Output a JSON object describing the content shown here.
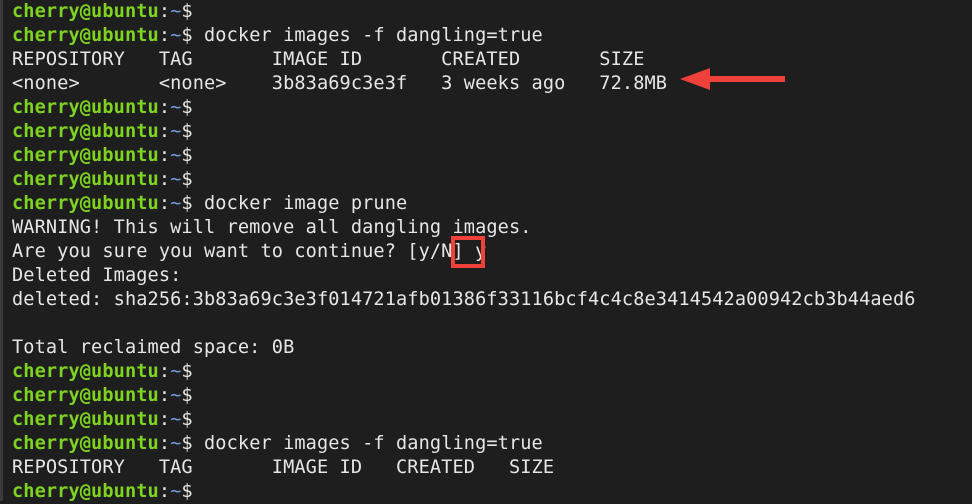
{
  "terminal": {
    "prompt": {
      "user_host": "cherry@ubuntu",
      "colon": ":",
      "path": "~",
      "symbol": "$"
    },
    "lines": [
      {
        "type": "prompt",
        "command": ""
      },
      {
        "type": "prompt",
        "command": " docker images -f dangling=true"
      },
      {
        "type": "output",
        "text": "REPOSITORY   TAG       IMAGE ID       CREATED       SIZE"
      },
      {
        "type": "output",
        "text": "<none>       <none>    3b83a69c3e3f   3 weeks ago   72.8MB"
      },
      {
        "type": "prompt",
        "command": ""
      },
      {
        "type": "prompt",
        "command": ""
      },
      {
        "type": "prompt",
        "command": ""
      },
      {
        "type": "prompt",
        "command": ""
      },
      {
        "type": "prompt",
        "command": " docker image prune"
      },
      {
        "type": "output",
        "text": "WARNING! This will remove all dangling images."
      },
      {
        "type": "output",
        "text": "Are you sure you want to continue? [y/N] y"
      },
      {
        "type": "output",
        "text": "Deleted Images:"
      },
      {
        "type": "output",
        "text": "deleted: sha256:3b83a69c3e3f014721afb01386f33116bcf4c4c8e3414542a00942cb3b44aed6"
      },
      {
        "type": "output",
        "text": ""
      },
      {
        "type": "output",
        "text": "Total reclaimed space: 0B"
      },
      {
        "type": "prompt",
        "command": ""
      },
      {
        "type": "prompt",
        "command": ""
      },
      {
        "type": "prompt",
        "command": ""
      },
      {
        "type": "prompt",
        "command": " docker images -f dangling=true"
      },
      {
        "type": "output",
        "text": "REPOSITORY   TAG       IMAGE ID   CREATED   SIZE"
      },
      {
        "type": "prompt",
        "command": ""
      }
    ]
  },
  "annotations": {
    "arrow_color": "#f0403a",
    "box_color": "#f0403a",
    "arrow_target": "72.8MB dangling image row",
    "box_target": "y confirmation input"
  },
  "colors": {
    "background": "#1e1e1e",
    "user_host": "#7ed321",
    "path": "#6a9fd8",
    "text": "#e6e6e6"
  }
}
